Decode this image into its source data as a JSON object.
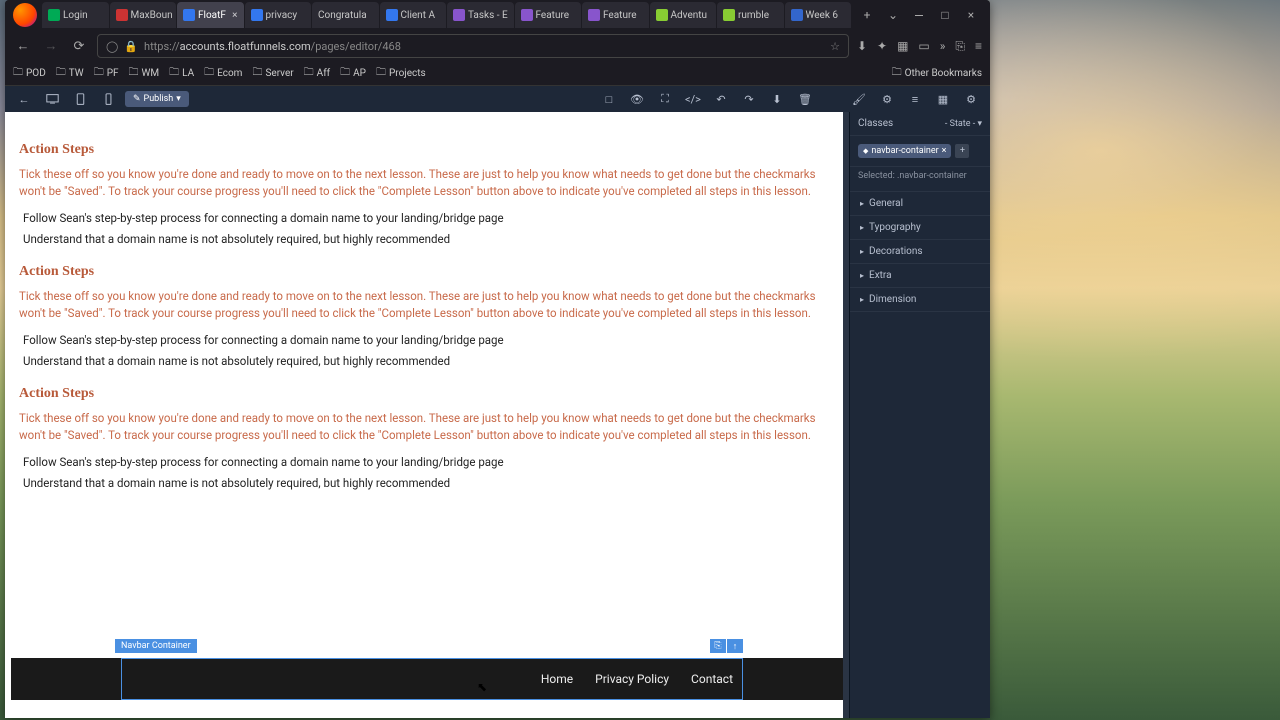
{
  "browser": {
    "tabs": [
      {
        "label": "Login",
        "icon": "green"
      },
      {
        "label": "MaxBoun",
        "icon": "red"
      },
      {
        "label": "FloatF",
        "icon": "blue",
        "active": true
      },
      {
        "label": "privacy",
        "icon": "blue"
      },
      {
        "label": "Congratula",
        "icon": ""
      },
      {
        "label": "Client A",
        "icon": "blue"
      },
      {
        "label": "Tasks - E",
        "icon": "purple"
      },
      {
        "label": "Feature",
        "icon": "purple"
      },
      {
        "label": "Feature",
        "icon": "purple"
      },
      {
        "label": "Adventu",
        "icon": "lime"
      },
      {
        "label": "rumble",
        "icon": "lime"
      },
      {
        "label": "Week 6",
        "icon": "cobalt"
      }
    ],
    "url_prefix": "https://",
    "url_host": "accounts.floatfunnels.com",
    "url_path": "/pages/editor/468",
    "bookmarks": [
      "POD",
      "TW",
      "PF",
      "WM",
      "LA",
      "Ecom",
      "Server",
      "Aff",
      "AP",
      "Projects"
    ],
    "other_bookmarks": "Other Bookmarks"
  },
  "editor": {
    "publish_label": "Publish",
    "selection_label": "Navbar Container",
    "nav_items": [
      "Home",
      "Privacy Policy",
      "Contact"
    ]
  },
  "content": {
    "heading": "Action Steps",
    "desc": "Tick these off so you know you're done and ready to move on to the next lesson. These are just to help you know what needs to get done but the checkmarks won't be \"Saved\". To track your course progress you'll need to click the \"Complete Lesson\" button above to indicate you've completed all steps in this lesson.",
    "step1": "Follow Sean's step-by-step process for connecting a domain name to your landing/bridge page",
    "step2": "Understand that a domain name is not absolutely required, but highly recommended"
  },
  "panel": {
    "classes_label": "Classes",
    "state_label": "- State -",
    "class_tag": "navbar-container",
    "class_close": "×",
    "selected_prefix": "Selected: ",
    "selected_value": ".navbar-container",
    "sections": [
      "General",
      "Typography",
      "Decorations",
      "Extra",
      "Dimension"
    ]
  }
}
